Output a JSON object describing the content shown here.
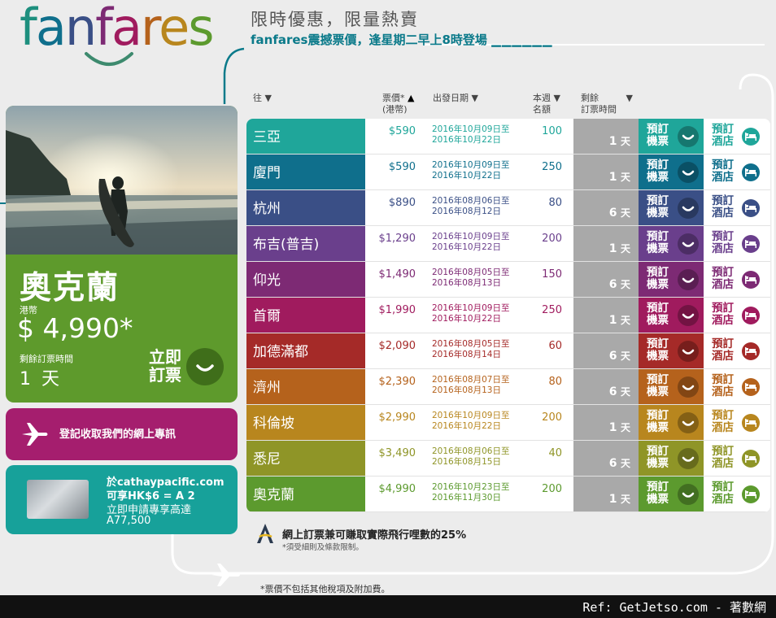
{
  "brand": {
    "logo_text": "fanfares"
  },
  "header": {
    "headline": "限時優惠，限量熱賣",
    "subline": "fanfares震撼票價，逢星期二早上8時登場"
  },
  "promo": {
    "city": "奧克蘭",
    "currency_label": "港幣",
    "price": "$ 4,990*",
    "remain_label": "剩餘訂票時間",
    "remain_value": "1 天",
    "book_label": "立即訂票"
  },
  "signup": {
    "text": "登記收取我們的網上專訊"
  },
  "card": {
    "line1": "於cathaypacific.com",
    "line2": "可享HK$6 = A 2",
    "line3": "立即申請專享高達",
    "line4": "A77,500"
  },
  "table": {
    "headers": {
      "dest": "往",
      "price": "票價*",
      "price_unit": "(港幣)",
      "date": "出發日期",
      "quota_l1": "本週",
      "quota_l2": "名額",
      "remain_l1": "剩餘",
      "remain_l2": "訂票時間"
    },
    "days_unit": "天",
    "book_flight": "預訂機票",
    "book_hotel": "預訂酒店",
    "rows": [
      {
        "dest": "三亞",
        "price": "$590",
        "date_from": "2016年10月09日至",
        "date_to": "2016年10月22日",
        "quota": "100",
        "days": "1",
        "color": "#1fa69a"
      },
      {
        "dest": "廈門",
        "price": "$590",
        "date_from": "2016年10月09日至",
        "date_to": "2016年10月22日",
        "quota": "250",
        "days": "1",
        "color": "#0f6f8c"
      },
      {
        "dest": "杭州",
        "price": "$890",
        "date_from": "2016年08月06日至",
        "date_to": "2016年08月12日",
        "quota": "80",
        "days": "6",
        "color": "#3a4f86"
      },
      {
        "dest": "布吉(普吉)",
        "price": "$1,290",
        "date_from": "2016年10月09日至",
        "date_to": "2016年10月22日",
        "quota": "200",
        "days": "1",
        "color": "#6a3f8c"
      },
      {
        "dest": "仰光",
        "price": "$1,490",
        "date_from": "2016年08月05日至",
        "date_to": "2016年08月13日",
        "quota": "150",
        "days": "6",
        "color": "#7d2a74"
      },
      {
        "dest": "首爾",
        "price": "$1,990",
        "date_from": "2016年10月09日至",
        "date_to": "2016年10月22日",
        "quota": "250",
        "days": "1",
        "color": "#a01b5e"
      },
      {
        "dest": "加德滿都",
        "price": "$2,090",
        "date_from": "2016年08月05日至",
        "date_to": "2016年08月14日",
        "quota": "60",
        "days": "6",
        "color": "#a52a28"
      },
      {
        "dest": "濟州",
        "price": "$2,390",
        "date_from": "2016年08月07日至",
        "date_to": "2016年08月13日",
        "quota": "80",
        "days": "6",
        "color": "#b5621c"
      },
      {
        "dest": "科倫坡",
        "price": "$2,990",
        "date_from": "2016年10月09日至",
        "date_to": "2016年10月22日",
        "quota": "200",
        "days": "1",
        "color": "#b8861e"
      },
      {
        "dest": "悉尼",
        "price": "$3,490",
        "date_from": "2016年08月06日至",
        "date_to": "2016年08月15日",
        "quota": "40",
        "days": "6",
        "color": "#8f9527"
      },
      {
        "dest": "奧克蘭",
        "price": "$4,990",
        "date_from": "2016年10月23日至",
        "date_to": "2016年11月30日",
        "quota": "200",
        "days": "1",
        "color": "#5c9a2e"
      }
    ]
  },
  "miles": {
    "text": "網上訂票兼可賺取實際飛行哩數的25%",
    "note": "*須受細則及條款限制。"
  },
  "footnote": "*票價不包括其他稅項及附加費。",
  "ref": "Ref: GetJetso.com - 著數網"
}
